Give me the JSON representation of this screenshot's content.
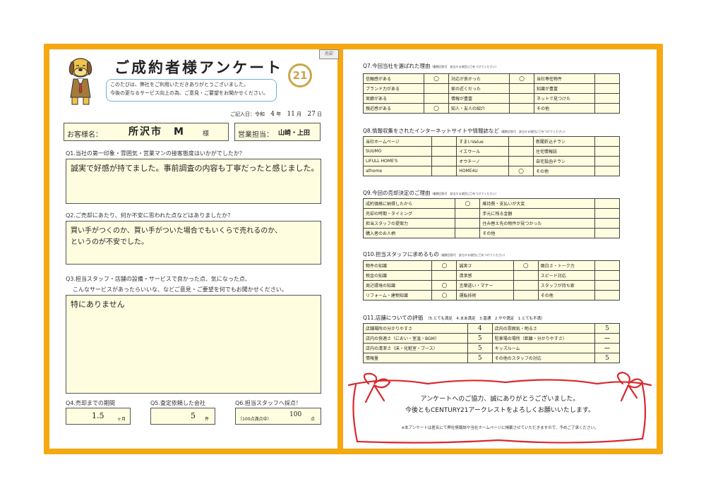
{
  "header": {
    "title": "ご成約者様アンケート",
    "greeting_1": "このたびは、弊社をご利用いただきありがとうございました。",
    "greeting_2": "今後の更なるサービス向上の為、ご意見・ご要望をお聞かせください。",
    "badge": "21",
    "corner_tag": "売却",
    "date_label": "ご記入日：",
    "era": "令和",
    "year": "4",
    "year_unit": "年",
    "month": "11",
    "month_unit": "月",
    "day": "27",
    "day_unit": "日"
  },
  "customer": {
    "label": "お客様名：",
    "name": "所沢市　M",
    "suffix": "様"
  },
  "staff": {
    "label": "営業担当：",
    "name": "山崎・上田"
  },
  "q1": {
    "question": "Q1.当社の第一印象・雰囲気・営業マンの接客態度はいかがでしたか？",
    "answer": "誠実で好感が持てました。事前調査の内容も丁寧だったと感じました。"
  },
  "q2": {
    "question": "Q2.ご売却にあたり、何か不安に思われた点などはありましたか？",
    "answer_1": "買い手がつくのか、買い手がついた場合でもいくらで売れるのか、",
    "answer_2": "というのが不安でした。"
  },
  "q3": {
    "question_1": "Q3.担当スタッフ・店舗の設備・サービスで良かった点、気になった点、",
    "question_2": "こんなサービスがあったらいいな、などご意見・ご要望を何でもお聞かせください。",
    "answer": "特にありません"
  },
  "q4": {
    "label": "Q4.売却までの期間",
    "value": "1.5",
    "unit": "ヶ月"
  },
  "q5": {
    "label": "Q5.査定依頼した会社",
    "value": "5",
    "unit": "件"
  },
  "q6": {
    "label": "Q6.担当スタッフへ採点！",
    "prefix": "（100点満点中）",
    "value": "100",
    "unit": "点"
  },
  "q7": {
    "title": "Q7.今回当社を選ばれた理由",
    "note": "（複数回答可　該当する項目に〇をつけてください）",
    "rows": [
      [
        {
          "t": "信頼感がある",
          "m": "○"
        },
        {
          "t": "対応が良かった",
          "m": "○"
        },
        {
          "t": "当社専任物件",
          "m": ""
        }
      ],
      [
        {
          "t": "ブランド力がある",
          "m": ""
        },
        {
          "t": "家の近くだった",
          "m": ""
        },
        {
          "t": "知識が豊富",
          "m": ""
        }
      ],
      [
        {
          "t": "実績がある",
          "m": ""
        },
        {
          "t": "情報が豊富",
          "m": ""
        },
        {
          "t": "ネットで見つけた",
          "m": ""
        }
      ],
      [
        {
          "t": "親近感がある",
          "m": "○"
        },
        {
          "t": "知人・友人の紹介",
          "m": ""
        },
        {
          "t": "その他",
          "m": ""
        }
      ]
    ]
  },
  "q8": {
    "title": "Q8.情報収集をされたインターネットサイトや情報誌など",
    "note": "（複数回答可　該当する項目に〇をつけてください）",
    "rows": [
      [
        {
          "t": "当社ホームページ",
          "m": ""
        },
        {
          "t": "すまいValue",
          "m": ""
        },
        {
          "t": "新聞折込チラシ",
          "m": ""
        }
      ],
      [
        {
          "t": "SUUMO",
          "m": ""
        },
        {
          "t": "イエウール",
          "m": ""
        },
        {
          "t": "住宅情報誌",
          "m": ""
        }
      ],
      [
        {
          "t": "LIFULL HOME'S",
          "m": ""
        },
        {
          "t": "オウチーノ",
          "m": ""
        },
        {
          "t": "自宅投函チラシ",
          "m": ""
        }
      ],
      [
        {
          "t": "athome",
          "m": ""
        },
        {
          "t": "HOME4U",
          "m": "○"
        },
        {
          "t": "その他",
          "m": ""
        }
      ]
    ]
  },
  "q9": {
    "title": "Q9.今回の売却決定のご理由",
    "note": "（複数回答可　該当する項目に〇をつけてください）",
    "rows": [
      [
        {
          "t": "成約価格に納得したから",
          "m": "○"
        },
        {
          "t": "維持費・支払いが大変",
          "m": ""
        }
      ],
      [
        {
          "t": "売却の時期・タイミング",
          "m": ""
        },
        {
          "t": "手元に残る金額",
          "m": ""
        }
      ],
      [
        {
          "t": "担当スタッフの提案力",
          "m": ""
        },
        {
          "t": "住み替え先の物件が見つかった",
          "m": ""
        }
      ],
      [
        {
          "t": "購入者のお人柄",
          "m": ""
        },
        {
          "t": "その他",
          "m": ""
        }
      ]
    ]
  },
  "q10": {
    "title": "Q10.担当スタッフに求めるもの",
    "note": "（複数回答可　該当する項目に〇をつけてください）",
    "rows": [
      [
        {
          "t": "物件の知識",
          "m": "○"
        },
        {
          "t": "誠実さ",
          "m": "○"
        },
        {
          "t": "面白さ・トーク力",
          "m": ""
        }
      ],
      [
        {
          "t": "税金の知識",
          "m": ""
        },
        {
          "t": "清潔感",
          "m": ""
        },
        {
          "t": "スピード対応",
          "m": ""
        }
      ],
      [
        {
          "t": "周辺環境の知識",
          "m": "○"
        },
        {
          "t": "言葉遣い・マナー",
          "m": ""
        },
        {
          "t": "スタッフが持ち家",
          "m": ""
        }
      ],
      [
        {
          "t": "リフォーム・建物知識",
          "m": "○"
        },
        {
          "t": "運転技術",
          "m": ""
        },
        {
          "t": "その他",
          "m": ""
        }
      ]
    ]
  },
  "q11": {
    "title": "Q11.店舗についての評価",
    "scale": "（5.とても満足　4.まあ満足　3.普通　2.やや満足　1.とても不満）",
    "rows": [
      [
        {
          "t": "店舗場所の分かりやすさ",
          "m": "4"
        },
        {
          "t": "店内の雰囲気・明るさ",
          "m": "5"
        }
      ],
      [
        {
          "t": "店内の快適さ（におい・室温・BGM）",
          "m": "5"
        },
        {
          "t": "駐車場の場所（距離・分かりやすさ）",
          "m": "ー"
        }
      ],
      [
        {
          "t": "店内の清潔さ（床・化粧室・ブース）",
          "m": "5"
        },
        {
          "t": "キッズルーム",
          "m": "ー"
        }
      ],
      [
        {
          "t": "情報量",
          "m": "5"
        },
        {
          "t": "その他のスタッフの対応",
          "m": "5"
        }
      ]
    ]
  },
  "footer": {
    "thanks_1": "アンケートへのご協力、誠にありがとうございました。",
    "thanks_2": "今後ともCENTURY21アークレストをよろしくお願いいたします。",
    "note": "※本アンケートは匿名にて弊社情報誌や当社ホームページに掲載させていただきますので、予めご了承ください。"
  },
  "colors": {
    "frame": "#f6a811",
    "field": "#fffde0",
    "ribbon": "#d9292e",
    "gold": "#c9a64a"
  }
}
